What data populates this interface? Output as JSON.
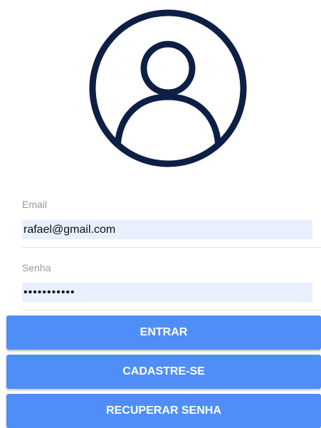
{
  "avatar": {
    "icon": "user-circle-icon",
    "color": "#0d1f45"
  },
  "form": {
    "email": {
      "label": "Email",
      "value": "rafael@gmail.com"
    },
    "password": {
      "label": "Senha",
      "value": "•••••••••••"
    }
  },
  "buttons": {
    "login_label": "ENTRAR",
    "signup_label": "CADASTRE-SE",
    "recover_label": "RECUPERAR SENHA"
  },
  "colors": {
    "button": "#4f8ef7",
    "input_background": "#e8f0fe",
    "label": "#9a9a9a"
  }
}
